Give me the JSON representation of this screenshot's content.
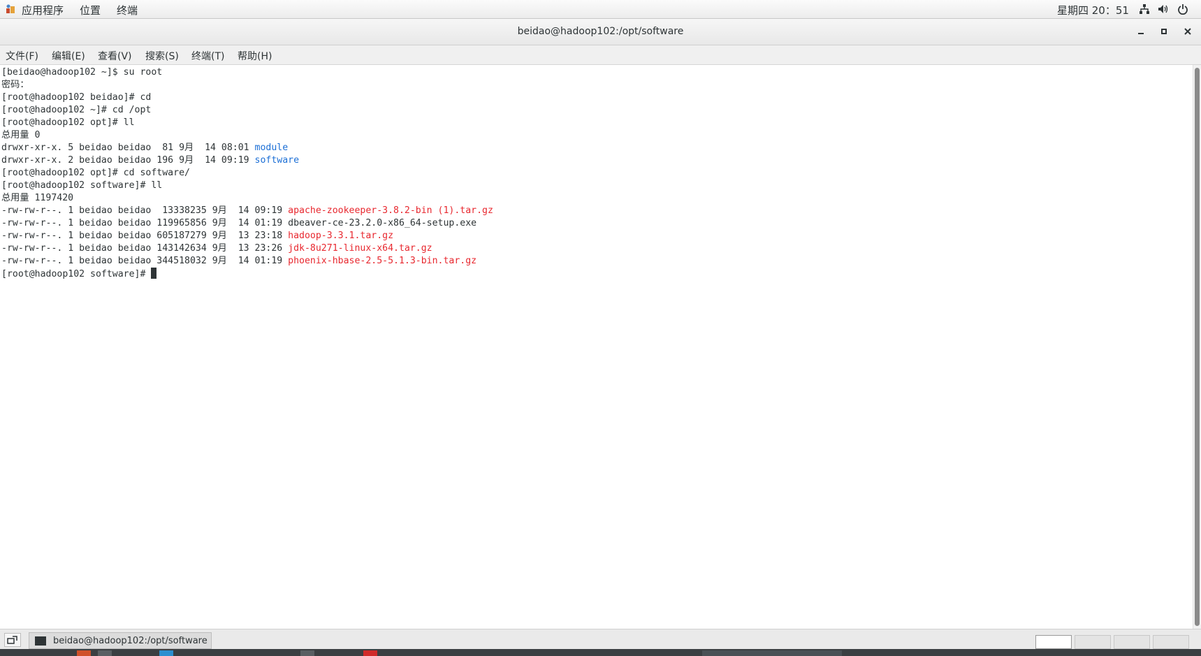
{
  "topbar": {
    "applications": "应用程序",
    "places": "位置",
    "terminal": "终端",
    "clock": "星期四 20：51",
    "tray_icons": [
      "network-icon",
      "volume-icon",
      "power-icon"
    ]
  },
  "window": {
    "title": "beidao@hadoop102:/opt/software",
    "buttons": [
      "minimize",
      "maximize",
      "close"
    ]
  },
  "menubar": {
    "items": [
      "文件(F)",
      "编辑(E)",
      "查看(V)",
      "搜索(S)",
      "终端(T)",
      "帮助(H)"
    ]
  },
  "terminal": {
    "lines": [
      {
        "text": "[beidao@hadoop102 ~]$ su root"
      },
      {
        "text": "密码："
      },
      {
        "text": "[root@hadoop102 beidao]# cd"
      },
      {
        "text": "[root@hadoop102 ~]# cd /opt"
      },
      {
        "text": "[root@hadoop102 opt]# ll"
      },
      {
        "text": "总用量 0"
      },
      {
        "prefix": "drwxr-xr-x. 5 beidao beidao  81 9月  14 08:01 ",
        "name": "module",
        "color": "#1c6fd6"
      },
      {
        "prefix": "drwxr-xr-x. 2 beidao beidao 196 9月  14 09:19 ",
        "name": "software",
        "color": "#1c6fd6"
      },
      {
        "text": "[root@hadoop102 opt]# cd software/"
      },
      {
        "text": "[root@hadoop102 software]# ll"
      },
      {
        "text": "总用量 1197420"
      },
      {
        "prefix": "-rw-rw-r--. 1 beidao beidao  13338235 9月  14 09:19 ",
        "name": "apache-zookeeper-3.8.2-bin (1).tar.gz",
        "color": "#e8282f"
      },
      {
        "prefix": "-rw-rw-r--. 1 beidao beidao 119965856 9月  14 01:19 ",
        "name": "dbeaver-ce-23.2.0-x86_64-setup.exe",
        "color": "#2e3436"
      },
      {
        "prefix": "-rw-rw-r--. 1 beidao beidao 605187279 9月  13 23:18 ",
        "name": "hadoop-3.3.1.tar.gz",
        "color": "#e8282f"
      },
      {
        "prefix": "-rw-rw-r--. 1 beidao beidao 143142634 9月  13 23:26 ",
        "name": "jdk-8u271-linux-x64.tar.gz",
        "color": "#e8282f"
      },
      {
        "prefix": "-rw-rw-r--. 1 beidao beidao 344518032 9月  14 01:19 ",
        "name": "phoenix-hbase-2.5-5.1.3-bin.tar.gz",
        "color": "#e8282f"
      }
    ],
    "prompt": "[root@hadoop102 software]# "
  },
  "taskbar": {
    "task_label": "beidao@hadoop102:/opt/software"
  }
}
